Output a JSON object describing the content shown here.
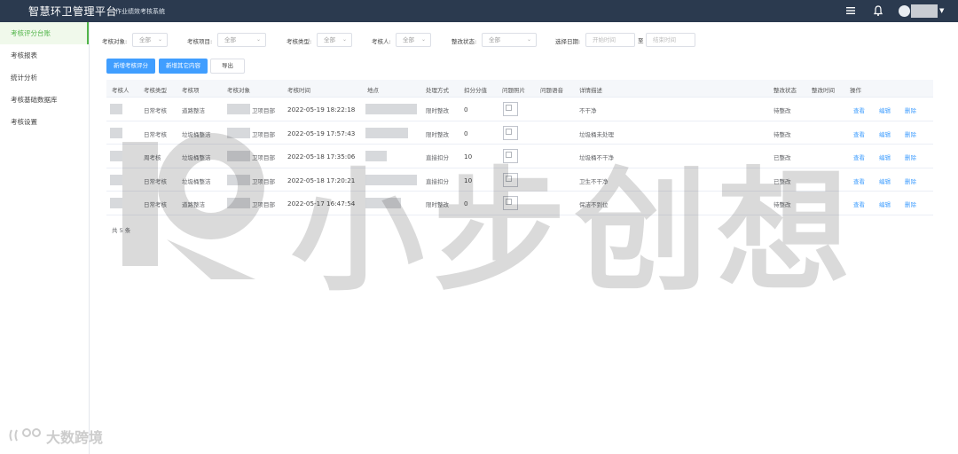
{
  "app": {
    "title": "智慧环卫管理平台",
    "subtitle": "作业绩效考核系统"
  },
  "sidebar": {
    "items": [
      {
        "label": "考核评分台账",
        "active": true
      },
      {
        "label": "考核报表",
        "active": false
      },
      {
        "label": "统计分析",
        "active": false
      },
      {
        "label": "考核基础数据库",
        "active": false
      },
      {
        "label": "考核设置",
        "active": false
      }
    ]
  },
  "filters": {
    "type_label": "考核对象:",
    "type_value": "全部",
    "project_label": "考核项目:",
    "project_value": "全部",
    "kind_label": "考核类型:",
    "kind_value": "全部",
    "person_label": "考核人:",
    "person_value": "全部",
    "status_label": "整改状态:",
    "status_value": "全部",
    "date_label": "选择日期:",
    "date_start_placeholder": "开始时间",
    "date_sep": "至",
    "date_end_placeholder": "结束时间"
  },
  "actions": {
    "add_score": "新增考核评分",
    "add_other": "新增其它内容",
    "export": "导出"
  },
  "table": {
    "headers": [
      "考核人",
      "考核类型",
      "考核项",
      "考核对象",
      "考核时间",
      "地点",
      "处理方式",
      "扣分分值",
      "问题照片",
      "问题语音",
      "详情描述",
      "整改状态",
      "整改时间",
      "操作"
    ],
    "rows": [
      {
        "kind": "日常考核",
        "item": "道路整洁",
        "obj_suffix": "卫项目部",
        "time": "2022-05-19 18:22:18",
        "method": "限时整改",
        "score": "0",
        "desc": "不干净",
        "status": "待整改"
      },
      {
        "kind": "日常考核",
        "item": "垃圾桶整洁",
        "obj_suffix": "卫项目部",
        "time": "2022-05-19 17:57:43",
        "method": "限时整改",
        "score": "0",
        "desc": "垃圾桶未处理",
        "status": "待整改"
      },
      {
        "kind": "周考核",
        "item": "垃圾桶整洁",
        "obj_suffix": "卫项目部",
        "time": "2022-05-18 17:35:06",
        "method": "直接扣分",
        "score": "10",
        "desc": "垃圾桶不干净",
        "status": "已整改"
      },
      {
        "kind": "日常考核",
        "item": "垃圾桶整洁",
        "obj_suffix": "卫项目部",
        "time": "2022-05-18 17:20:21",
        "method": "直接扣分",
        "score": "10",
        "desc": "卫生不干净",
        "status": "已整改"
      },
      {
        "kind": "日常考核",
        "item": "道路整洁",
        "obj_suffix": "卫项目部",
        "time": "2022-05-17 16:47:54",
        "method": "限时整改",
        "score": "0",
        "desc": "保洁不到位",
        "status": "待整改"
      }
    ],
    "ops": {
      "view": "查看",
      "edit": "编辑",
      "delete": "删除"
    },
    "total": "共 5 条"
  },
  "watermark": {
    "text": "小步创想",
    "corner": "大数跨境"
  },
  "colors": {
    "topbar": "#2b3a4f",
    "accent_green": "#52b54a",
    "primary_blue": "#409eff"
  }
}
